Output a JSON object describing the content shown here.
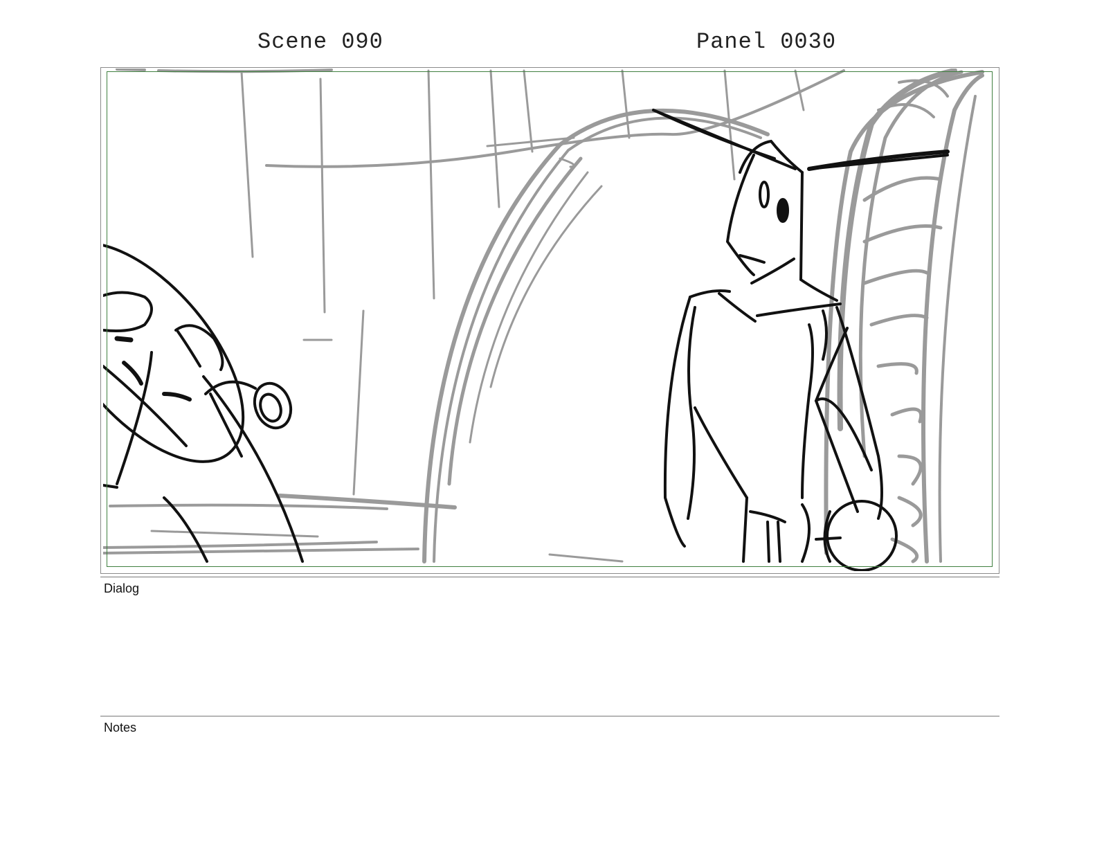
{
  "header": {
    "scene": "Scene 090",
    "panel": "Panel 0030"
  },
  "sections": {
    "dialog_label": "Dialog",
    "dialog_text": "",
    "notes_label": "Notes",
    "notes_text": ""
  },
  "colors": {
    "frame_border": "#8a8a8a",
    "safe_area_border": "#3f7f3f",
    "background_lines": "#9a9a9a",
    "character_lines": "#111111"
  }
}
